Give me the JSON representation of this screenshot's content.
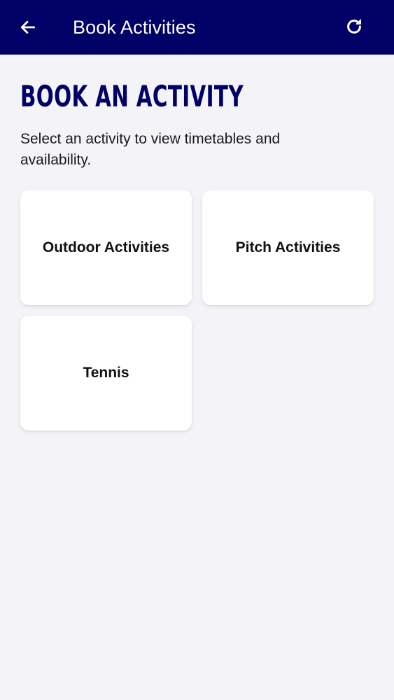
{
  "app_bar": {
    "title": "Book Activities",
    "back_icon": "arrow-left-icon",
    "refresh_icon": "refresh-icon",
    "background_color": "#010066"
  },
  "main": {
    "heading": "BOOK AN ACTIVITY",
    "subtitle": "Select an activity to view timetables and availability.",
    "cards": [
      {
        "label": "Outdoor Activities"
      },
      {
        "label": "Pitch Activities"
      },
      {
        "label": "Tennis"
      }
    ]
  }
}
